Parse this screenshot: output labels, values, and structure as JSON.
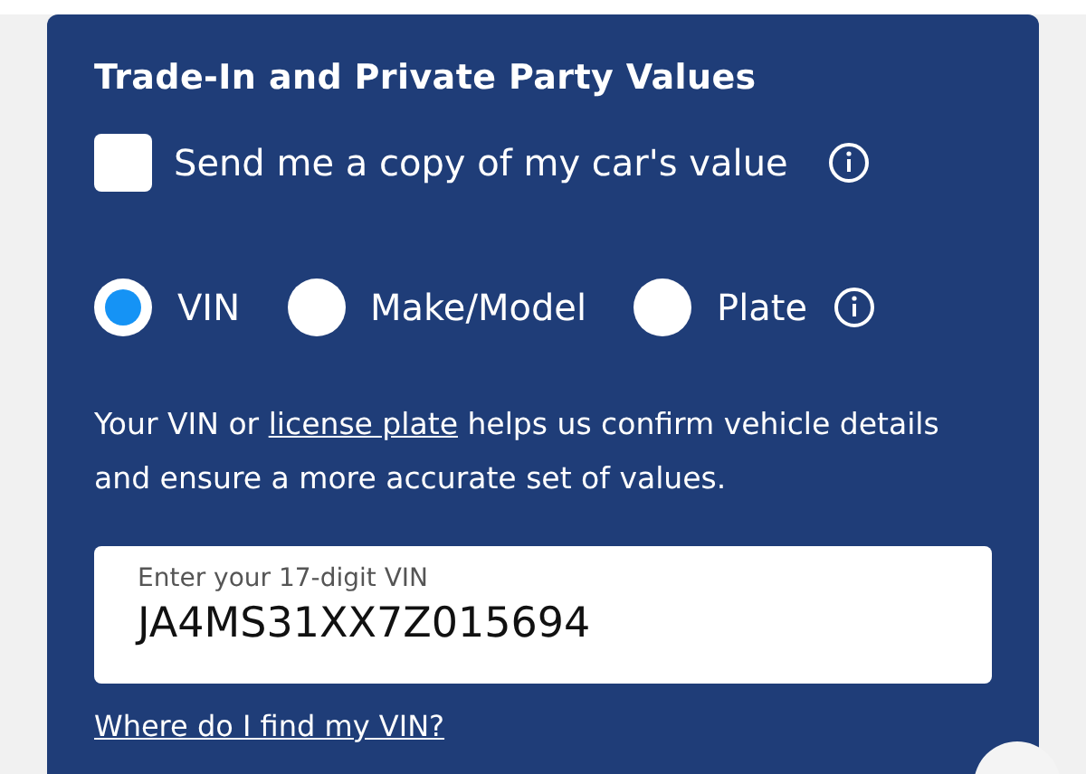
{
  "card": {
    "title": "Trade-In and Private Party Values",
    "copy_option": {
      "label": "Send me a copy of my car's value",
      "checked": false
    },
    "lookup_options": [
      {
        "label": "VIN",
        "selected": true,
        "info": false
      },
      {
        "label": "Make/Model",
        "selected": false,
        "info": false
      },
      {
        "label": "Plate",
        "selected": false,
        "info": true
      }
    ],
    "help_text": {
      "before": "Your VIN or ",
      "link": "license plate",
      "after": " helps us confirm vehicle details and ensure a more accurate set of values."
    },
    "vin_field": {
      "label": "Enter your 17-digit VIN",
      "value": "JA4MS31XX7Z015694"
    },
    "help_link": "Where do I find my VIN?"
  }
}
